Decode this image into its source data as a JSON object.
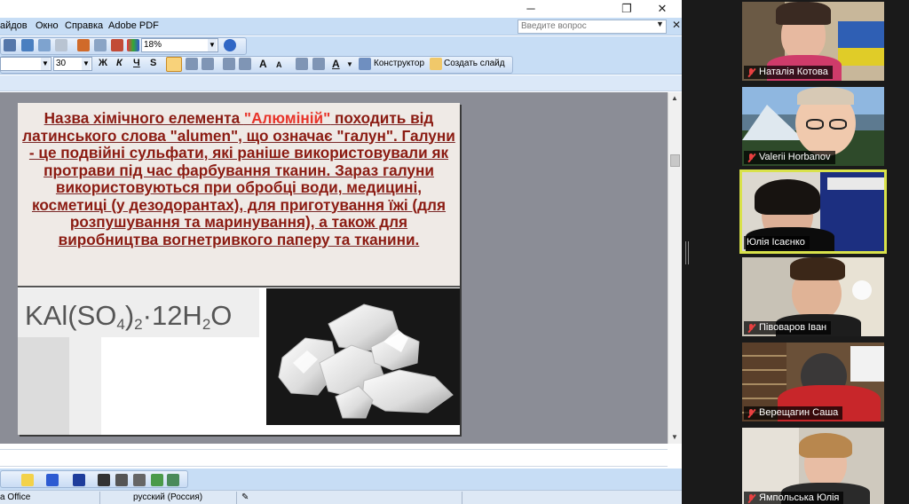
{
  "window": {
    "minimize_icon": "minimize-icon",
    "maximize_icon": "restore-icon",
    "close_icon": "close-icon"
  },
  "menu": {
    "items": [
      "айдов",
      "Окно",
      "Справка",
      "Adobe PDF"
    ],
    "help_search_placeholder": "Введите вопрос"
  },
  "toolbar": {
    "zoom_value": "18%",
    "font_size": "30",
    "bold": "Ж",
    "italic": "К",
    "underline": "Ч",
    "shadow": "S",
    "grow_font": "A",
    "shrink_font": "A",
    "font_color": "A",
    "designer_label": "Конструктор",
    "new_slide_label": "Создать слайд"
  },
  "slide": {
    "text_runs": [
      {
        "t": "Назва хімічного елемента ",
        "red": false
      },
      {
        "t": "\"Алюміній\"",
        "red": true
      },
      {
        "t": " походить від латинського слова \"alumen\", що означає \"галун\". Галуни - це подвійні сульфати, які раніше використовували як протрави під час фарбування тканин. Зараз галуни використовуються при обробці води, медицині, косметиці (у дезодорантах), для приготування їжі (для розпушування та маринування), а також для виробництва вогнетривкого паперу та тканини.",
        "red": false
      }
    ],
    "formula": {
      "part1": "KAl(SO",
      "sub1": "4",
      "part2": ")",
      "sub2": "2",
      "part3": "·12H",
      "sub3": "2",
      "part4": "O"
    }
  },
  "statusbar": {
    "left": "a Office",
    "language": "русский (Россия)"
  },
  "participants": [
    {
      "name": "Наталія Котова",
      "muted": true
    },
    {
      "name": "Valerii Horbanov",
      "muted": true
    },
    {
      "name": "Юлія Ісаєнко",
      "muted": false,
      "active": true
    },
    {
      "name": "Півоваров Іван",
      "muted": true
    },
    {
      "name": "Верещагин Саша",
      "muted": true
    },
    {
      "name": "Ямпольська Юлія",
      "muted": true
    }
  ],
  "colors": {
    "slide_text": "#8b1b12",
    "highlight_red": "#e8342a",
    "active_speaker_border": "#d9e24a",
    "office_blue": "#c7ddf5"
  }
}
